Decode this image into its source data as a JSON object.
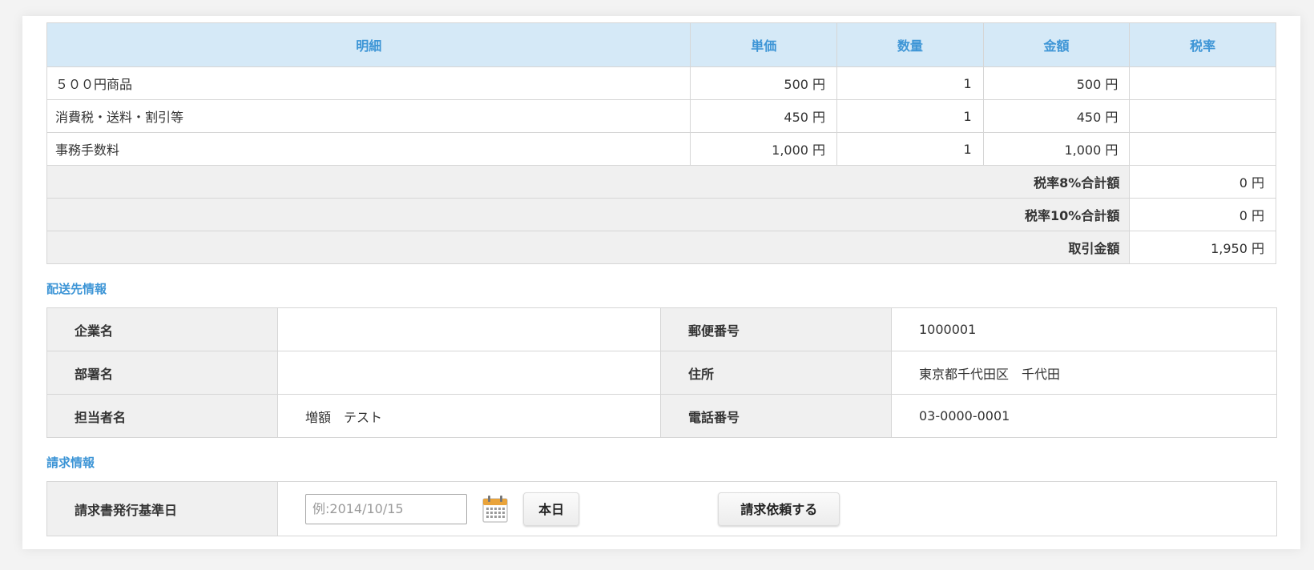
{
  "detail_table": {
    "headers": {
      "item": "明細",
      "unit_price": "単価",
      "quantity": "数量",
      "amount": "金額",
      "tax_rate": "税率"
    },
    "rows": [
      {
        "item": "５００円商品",
        "unit_price": "500 円",
        "quantity": "1",
        "amount": "500 円",
        "tax_rate": ""
      },
      {
        "item": "消費税・送料・割引等",
        "unit_price": "450 円",
        "quantity": "1",
        "amount": "450 円",
        "tax_rate": ""
      },
      {
        "item": "事務手数料",
        "unit_price": "1,000 円",
        "quantity": "1",
        "amount": "1,000 円",
        "tax_rate": ""
      }
    ],
    "summary": [
      {
        "label": "税率8%合計額",
        "value": "0 円"
      },
      {
        "label": "税率10%合計額",
        "value": "0 円"
      },
      {
        "label": "取引金額",
        "value": "1,950 円"
      }
    ]
  },
  "shipping": {
    "title": "配送先情報",
    "company_label": "企業名",
    "company_value": "",
    "postal_label": "郵便番号",
    "postal_value": "1000001",
    "department_label": "部署名",
    "department_value": "",
    "address_label": "住所",
    "address_value": "東京都千代田区　千代田",
    "contact_label": "担当者名",
    "contact_value": "増額　テスト",
    "phone_label": "電話番号",
    "phone_value": "03-0000-0001"
  },
  "billing": {
    "title": "請求情報",
    "date_label": "請求書発行基準日",
    "date_placeholder": "例:2014/10/15",
    "date_value": "",
    "today_button": "本日",
    "request_button": "請求依頼する",
    "calendar_icon": "calendar-icon"
  },
  "colors": {
    "accent": "#3d95d6",
    "header_bg": "#d5e9f7",
    "label_bg": "#f0f0f0",
    "border": "#d6d6d6"
  }
}
